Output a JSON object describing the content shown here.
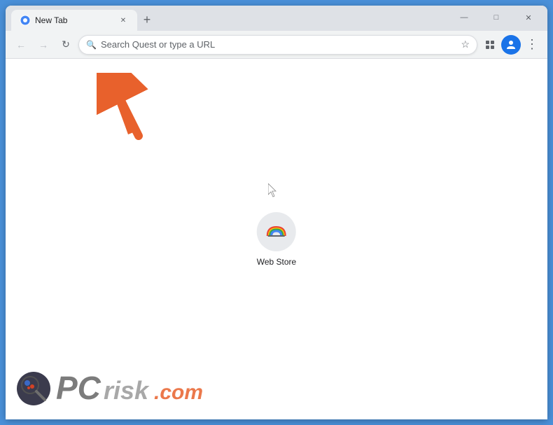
{
  "browser": {
    "tab": {
      "title": "New Tab",
      "favicon": "circle-icon"
    },
    "window_controls": {
      "minimize": "—",
      "maximize": "□",
      "close": "✕"
    },
    "toolbar": {
      "back_label": "←",
      "forward_label": "→",
      "reload_label": "↻",
      "search_placeholder": "Search Quest or type a URL",
      "star_label": "☆",
      "extensions_label": "⬜",
      "menu_label": "⋮"
    },
    "new_tab_button": "+"
  },
  "page": {
    "web_store": {
      "label": "Web Store"
    }
  },
  "watermark": {
    "text": "PCrisk.com"
  },
  "annotation": {
    "arrow_color": "#e8612c"
  }
}
